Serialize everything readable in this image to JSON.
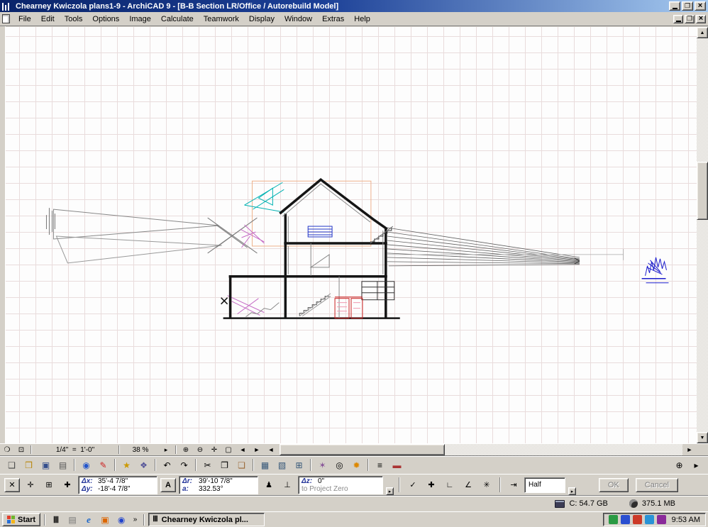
{
  "colors": {
    "titlebar_blue": "#0a246a",
    "window_face": "#d4d0c8",
    "grid_line": "#e9dcdc",
    "drawing_ink": "#151515",
    "drawing_red": "#cc2222",
    "drawing_blue": "#2233bb",
    "drawing_cyan": "#00b2b2",
    "drawing_magenta": "#c66cc6"
  },
  "titlebar": {
    "title": "Chearney Kwiczola plans1-9 - ArchiCAD 9 - [B-B Section LR/Office / Autorebuild Model]"
  },
  "menubar": {
    "items": [
      "File",
      "Edit",
      "Tools",
      "Options",
      "Image",
      "Calculate",
      "Teamwork",
      "Display",
      "Window",
      "Extras",
      "Help"
    ]
  },
  "bottombar": {
    "scale": "1/4\"  =  1'-0\"",
    "zoom_percent": "38 %"
  },
  "coordbar": {
    "dx_label": "Δx:",
    "dx_value": "35'-4 7/8\"",
    "dy_label": "Δy:",
    "dy_value": "-18'-4 7/8\"",
    "angle_button_label": "A",
    "dr_label": "Δr:",
    "dr_value": "39'-10 7/8\"",
    "a_label": "a:",
    "a_value": "332.53°",
    "dz_label": "Δz:",
    "dz_value": "0\"",
    "dz_reference": "to Project Zero",
    "half_value": "Half",
    "ok_label": "OK",
    "cancel_label": "Cancel"
  },
  "status_indicators": {
    "disk": "C: 54.7 GB",
    "memory": "375.1 MB"
  },
  "taskbar": {
    "start_label": "Start",
    "quicklaunch_chevron": "»",
    "task_label": "Chearney Kwiczola pl...",
    "time": "9:53 AM"
  },
  "icons": {
    "minimize": "",
    "restore": "❐",
    "close": "×",
    "new_document": "❑",
    "open": "❒",
    "save": "▣",
    "print": "▤",
    "publish": "◉",
    "markup_pen": "✎",
    "favorites": "★",
    "library": "❖",
    "undo": "↶",
    "redo": "↷",
    "cut": "✂",
    "copy": "❐",
    "paste": "❏",
    "story_settings": "▦",
    "layers": "▧",
    "grid_snap": "⊞",
    "magic_wand": "✶",
    "camera": "◎",
    "sun_study": "✹",
    "element_list": "≡",
    "construct": "▬",
    "zoom_tool": "⊕",
    "more_tools": "▸",
    "quick_options": "❍",
    "marquee_zoom": "⊡",
    "zoom_in": "⊕",
    "zoom_out": "⊖",
    "pan": "✛",
    "fit_window": "▢",
    "prev_view": "◄",
    "next_view": "►",
    "scroll_up": "▲",
    "scroll_down": "▼",
    "scroll_left": "◄",
    "scroll_right": "►",
    "tracker": "✕",
    "relative_origin": "✛",
    "grid_toggle": "⊞",
    "origin": "✚",
    "gravity": "♟",
    "dz": "⊥",
    "confirm": "✓",
    "add_point": "✚",
    "perpendicular": "∟",
    "angle_snap": "∠",
    "compass": "✳",
    "half": "⇥",
    "dropdown": "▸",
    "archicad": "Ⅲ",
    "notes": "▤",
    "internet_explorer": "e",
    "media": "▣",
    "player": "◉"
  }
}
